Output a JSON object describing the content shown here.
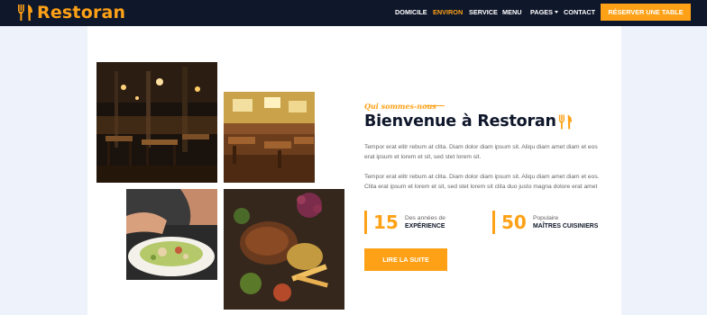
{
  "brand": {
    "name": "Restoran",
    "icon": "utensils-icon",
    "color": "#fea116"
  },
  "nav": {
    "items": [
      {
        "label": "DOMICILE",
        "active": false
      },
      {
        "label": "ENVIRON",
        "active": true
      },
      {
        "label": "SERVICE",
        "active": false
      },
      {
        "label": "MENU",
        "active": false
      },
      {
        "label": "PAGES",
        "active": false,
        "dropdown": true
      },
      {
        "label": "CONTACT",
        "active": false
      }
    ],
    "cta": "RÉSERVER UNE TABLE"
  },
  "about": {
    "subtitle": "Qui sommes-nous",
    "title": "Bienvenue à Restoran",
    "title_icon": "utensils-icon",
    "paragraphs": [
      "Tempor erat elitr rebum at clita. Diam dolor diam ipsum sit. Aliqu diam amet diam et eos erat ipsum et lorem et sit, sed stet lorem sit.",
      "Tempor erat elitr rebum at clita. Diam dolor diam ipsum sit. Aliqu diam amet diam et eos. Clita erat ipsum et lorem et sit, sed stet lorem sit clita duo justo magna dolore erat amet"
    ],
    "stats": [
      {
        "number": "15",
        "top": "Des années de",
        "bottom": "EXPÉRIENCE"
      },
      {
        "number": "50",
        "top": "Populaire",
        "bottom": "MAÎTRES CUISINIERS"
      }
    ],
    "button": "LIRE LA SUITE",
    "images": [
      "restaurant-interior-dark",
      "restaurant-interior-bright",
      "salad-plate",
      "food-platter"
    ]
  },
  "colors": {
    "accent": "#fea116",
    "dark": "#0f172b",
    "background": "#eef2fa"
  }
}
